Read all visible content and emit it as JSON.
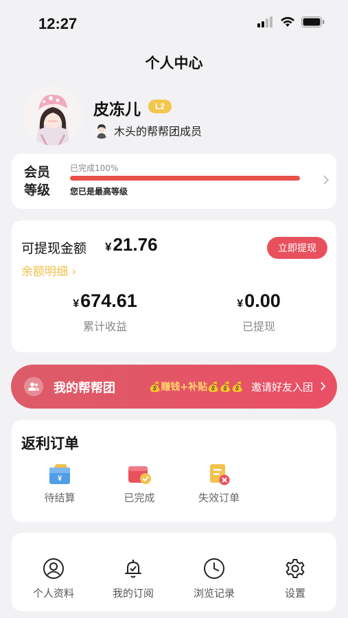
{
  "status_bar": {
    "time": "12:27"
  },
  "nav": {
    "title": "个人中心"
  },
  "profile": {
    "username": "皮冻儿",
    "level_badge": "L2",
    "team_label": "木头的帮帮团成员"
  },
  "membership": {
    "label": "会员等级",
    "completed_text": "已完成100%",
    "progress_percent": 100,
    "status_text": "您已是最高等级"
  },
  "wallet": {
    "withdrawable_label": "可提现金额",
    "currency_symbol": "¥",
    "withdrawable_amount": "21.76",
    "withdraw_button": "立即提现",
    "balance_detail": "余额明细 ›",
    "total_income_value": "674.61",
    "total_income_label": "累计收益",
    "withdrawn_value": "0.00",
    "withdrawn_label": "已提现"
  },
  "team_banner": {
    "title": "我的帮帮团",
    "promo": "💰赚钱+补贴💰💰💰",
    "invite": "邀请好友入团"
  },
  "orders": {
    "title": "返利订单",
    "items": [
      {
        "label": "待结算",
        "icon": "pending-settlement-icon"
      },
      {
        "label": "已完成",
        "icon": "completed-wallet-icon"
      },
      {
        "label": "失效订单",
        "icon": "invalid-order-icon"
      }
    ]
  },
  "menu": {
    "items": [
      {
        "label": "个人资料",
        "icon": "user-profile-icon"
      },
      {
        "label": "我的订阅",
        "icon": "bell-icon"
      },
      {
        "label": "浏览记录",
        "icon": "clock-icon"
      },
      {
        "label": "设置",
        "icon": "gear-icon"
      }
    ]
  },
  "colors": {
    "accent": "#e8505e",
    "progress": "#e8524a",
    "gold": "#f0c04a",
    "background": "#f2f2f4"
  }
}
